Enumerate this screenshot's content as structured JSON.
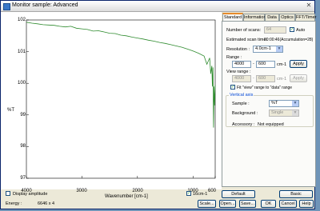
{
  "window": {
    "title": "Monitor sample: Advanced",
    "close_glyph": "✕"
  },
  "plot": {
    "y_axis_label": "%T",
    "x_axis_label": "Wavenumber [cm-1]",
    "y_ticks": [
      "102",
      "101",
      "100",
      "99",
      "98",
      "97"
    ],
    "x_ticks": [
      "4000",
      "3000",
      "2000",
      "1000",
      "600"
    ],
    "line_color": "#2e8b2e"
  },
  "chart_data": {
    "type": "line",
    "xlabel": "Wavenumber [cm-1]",
    "ylabel": "%T",
    "xlim": [
      4000,
      600
    ],
    "ylim": [
      97,
      102
    ],
    "series": [
      {
        "x": [
          4000,
          3900,
          3800,
          3700,
          3600,
          3500,
          3400,
          3300,
          3200,
          3100,
          3000,
          2900,
          2800,
          2700,
          2600,
          2500,
          2400,
          2300,
          2200,
          2100,
          2000,
          1900,
          1800,
          1700,
          1600,
          1500,
          1400,
          1300,
          1200,
          1100,
          1000,
          900,
          800,
          750,
          700,
          680,
          660,
          650,
          640,
          630,
          620,
          610,
          600
        ],
        "y": [
          101.93,
          101.9,
          101.88,
          101.85,
          101.84,
          101.83,
          101.8,
          101.78,
          101.8,
          101.74,
          101.72,
          101.7,
          101.65,
          101.66,
          101.62,
          101.58,
          101.57,
          101.52,
          101.5,
          101.46,
          101.43,
          101.4,
          101.36,
          101.33,
          101.29,
          101.26,
          101.22,
          101.18,
          101.14,
          101.08,
          101.02,
          100.95,
          100.86,
          100.6,
          100.8,
          100.3,
          100.55,
          99.9,
          100.5,
          98.6,
          99.9,
          99.3,
          99.95
        ]
      }
    ]
  },
  "tabs": [
    "Standard",
    "Information",
    "Data",
    "Optics",
    "FFT/Timer"
  ],
  "standard": {
    "number_of_scans_label": "Number of scans:",
    "number_of_scans_value": "64",
    "auto_label": "Auto",
    "auto_checked": "✓",
    "estimated_time_label": "Estimated scan time:",
    "estimated_time_value": "00:00:46(Accumulation=28)",
    "resolution_label": "Resolution :",
    "resolution_value": "4.0cm-1",
    "range_label": "Range :",
    "range_from": "4000",
    "range_to": "600",
    "range_unit": "cm-1",
    "apply_label": "Apply",
    "view_range_label": "View range :",
    "view_from": "4000",
    "view_to": "600",
    "view_unit": "cm-1",
    "view_apply_label": "Apply",
    "fit_label": "Fit \"view\" range to \"data\" range",
    "fit_checked": "✓",
    "vertical_axis_title": "Vertical axis",
    "sample_label": "Sample :",
    "sample_value": "%T",
    "background_label": "Background :",
    "background_value": "Single",
    "accessory_label": "Accessory :",
    "accessory_value": "Not equipped"
  },
  "bottom": {
    "display_amplitude_label": "Display amplitude",
    "energy_label": "Energy :",
    "energy_value": "6646 x 4",
    "resolution_check_label": "16cm-1",
    "resolution_checked": "✓",
    "default_label": "Default",
    "basic_label": "Basic",
    "buttons": [
      "Scale...",
      "Open...",
      "Save...",
      "OK",
      "Cancel",
      "Help"
    ]
  }
}
